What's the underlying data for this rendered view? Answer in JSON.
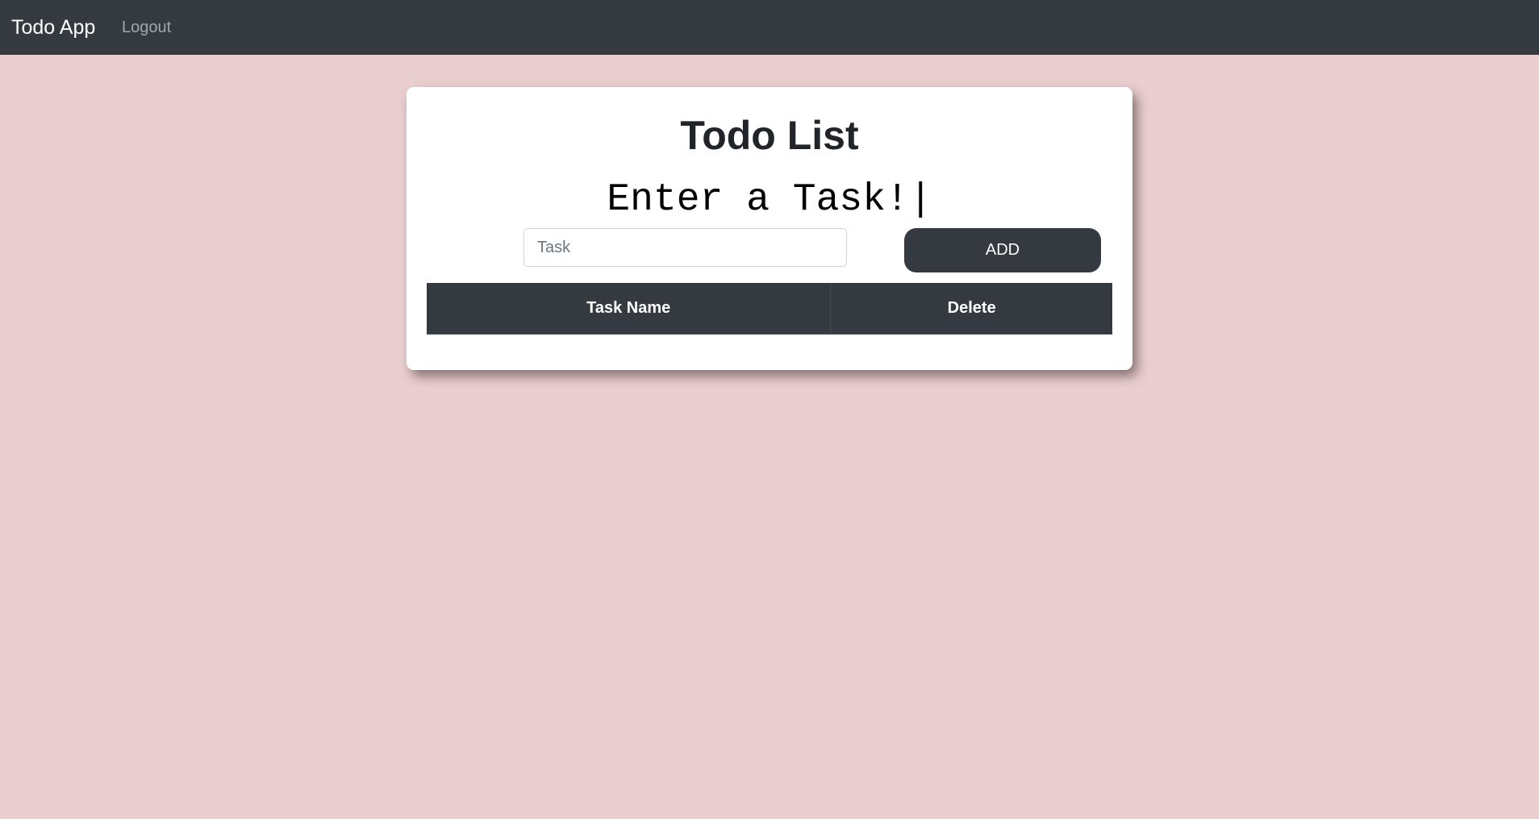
{
  "navbar": {
    "brand": "Todo App",
    "logout_label": "Logout"
  },
  "card": {
    "title": "Todo List",
    "typing_text": "Enter a Task!|",
    "task_input": {
      "placeholder": "Task",
      "value": ""
    },
    "add_label": "ADD",
    "table": {
      "headers": [
        "Task Name",
        "Delete"
      ],
      "rows": []
    }
  },
  "colors": {
    "background": "#e9cfd0",
    "navbar": "#343a40",
    "button": "#343a40",
    "card": "#ffffff"
  }
}
